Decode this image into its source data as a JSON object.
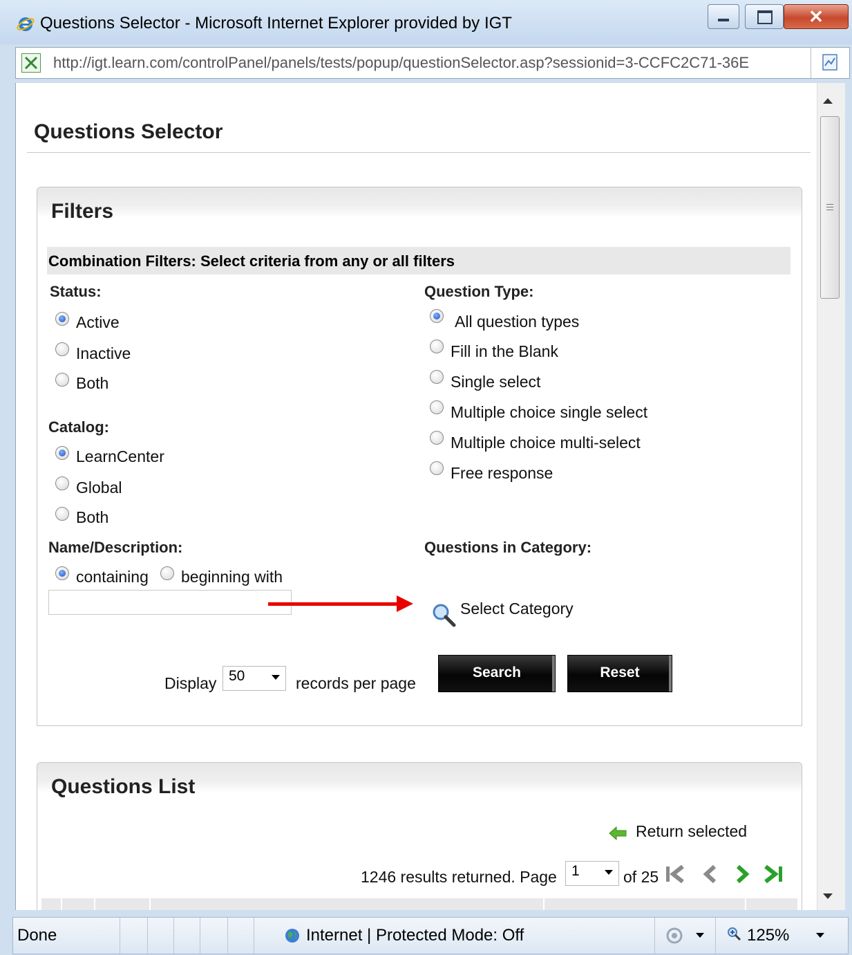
{
  "window": {
    "title": "Questions Selector - Microsoft Internet Explorer provided by IGT",
    "url": "http://igt.learn.com/controlPanel/panels/tests/popup/questionSelector.asp?sessionid=3-CCFC2C71-36E"
  },
  "page": {
    "title": "Questions Selector"
  },
  "filters": {
    "title": "Filters",
    "combination_label": "Combination Filters: Select criteria from any or all filters",
    "status": {
      "label": "Status:",
      "options": [
        "Active",
        "Inactive",
        "Both"
      ],
      "selected": "Active"
    },
    "catalog": {
      "label": "Catalog:",
      "options": [
        "LearnCenter",
        "Global",
        "Both"
      ],
      "selected": "LearnCenter"
    },
    "name_description": {
      "label": "Name/Description:",
      "options": [
        "containing",
        "beginning with"
      ],
      "selected": "containing",
      "value": ""
    },
    "question_type": {
      "label": "Question Type:",
      "options": [
        "All question types",
        "Fill in the Blank",
        "Single select",
        "Multiple choice single select",
        "Multiple choice multi-select",
        "Free response"
      ],
      "selected": "All question types"
    },
    "category": {
      "label": "Questions in Category:",
      "select_label": "Select Category"
    },
    "display_label": "Display",
    "records_per_page": "50",
    "records_label": "records per page",
    "search_button": "Search",
    "reset_button": "Reset"
  },
  "questions_list": {
    "title": "Questions List",
    "return_selected": "Return selected",
    "results_text": "1246 results returned. Page",
    "page": "1",
    "of_text": "of 25"
  },
  "statusbar": {
    "status": "Done",
    "zone": "Internet | Protected Mode: Off",
    "zoom": "125%"
  },
  "colors": {
    "accent_red": "#e80000",
    "button_black": "#111111",
    "nav_green": "#2aa12a",
    "nav_grey": "#8a8a8a"
  }
}
